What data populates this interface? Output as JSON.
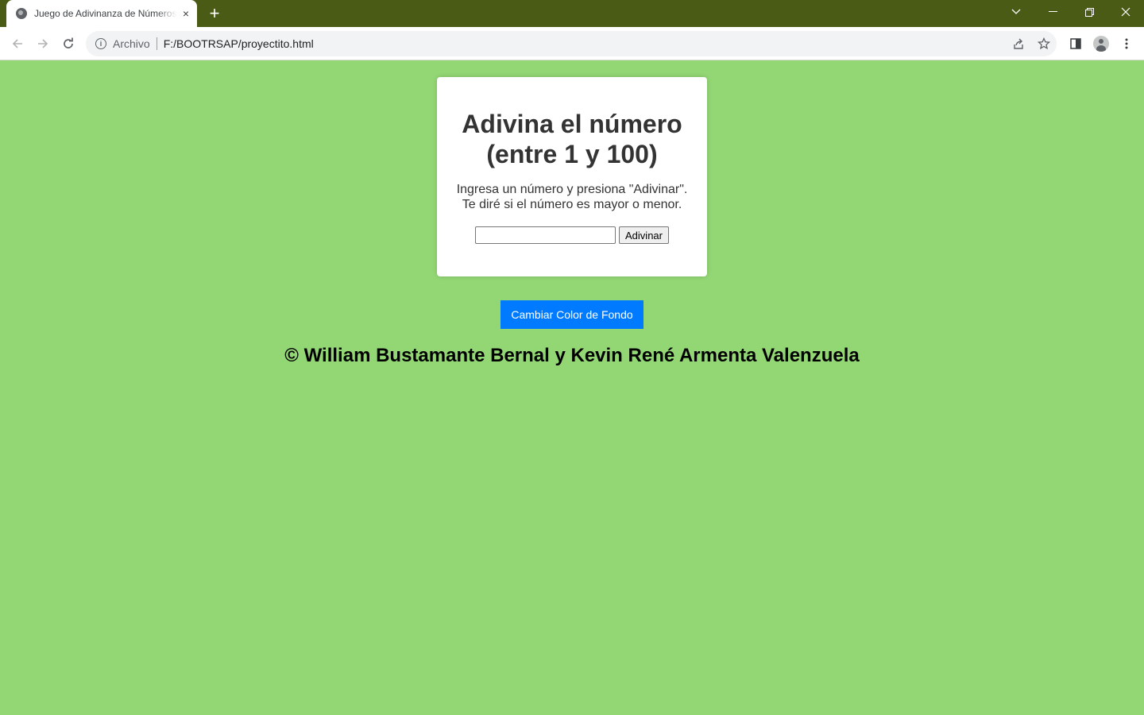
{
  "browser": {
    "tab_title": "Juego de Adivinanza de Números",
    "tab_close": "×",
    "new_tab": "+",
    "security_label": "Archivo",
    "url": "F:/BOOTRSAP/proyectito.html",
    "titlebar_color": "#4a5b16"
  },
  "page": {
    "background_color": "#93d775",
    "card": {
      "title_line1": "Adivina el número",
      "title_line2": "(entre 1 y 100)",
      "instructions": "Ingresa un número y presiona \"Adivinar\". Te diré si el número es mayor o menor.",
      "input_value": "",
      "guess_button": "Adivinar"
    },
    "change_color_button": "Cambiar Color de Fondo",
    "button_color": "#007bff",
    "credit": "© William Bustamante Bernal y Kevin René Armenta Valenzuela"
  }
}
